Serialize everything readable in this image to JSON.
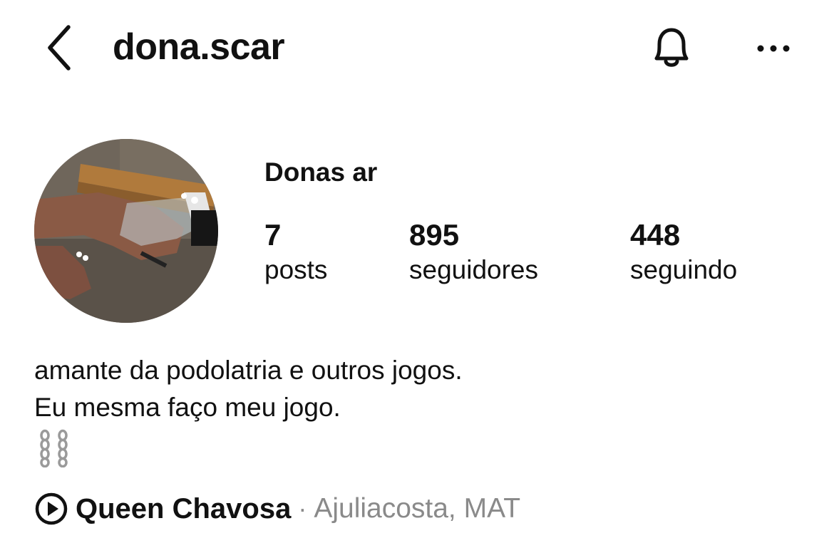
{
  "header": {
    "username": "dona.scar"
  },
  "profile": {
    "display_name": "Donas ar",
    "stats": [
      {
        "value": "7",
        "label": "posts"
      },
      {
        "value": "895",
        "label": "seguidores"
      },
      {
        "value": "448",
        "label": "seguindo"
      }
    ],
    "bio": [
      "amante da podolatria e outros jogos.",
      "Eu mesma faço meu jogo."
    ],
    "bio_emoji": "chains-emoji"
  },
  "music": {
    "song": "Queen Chavosa",
    "separator": "·",
    "artist": "Ajuliacosta, MAT"
  }
}
